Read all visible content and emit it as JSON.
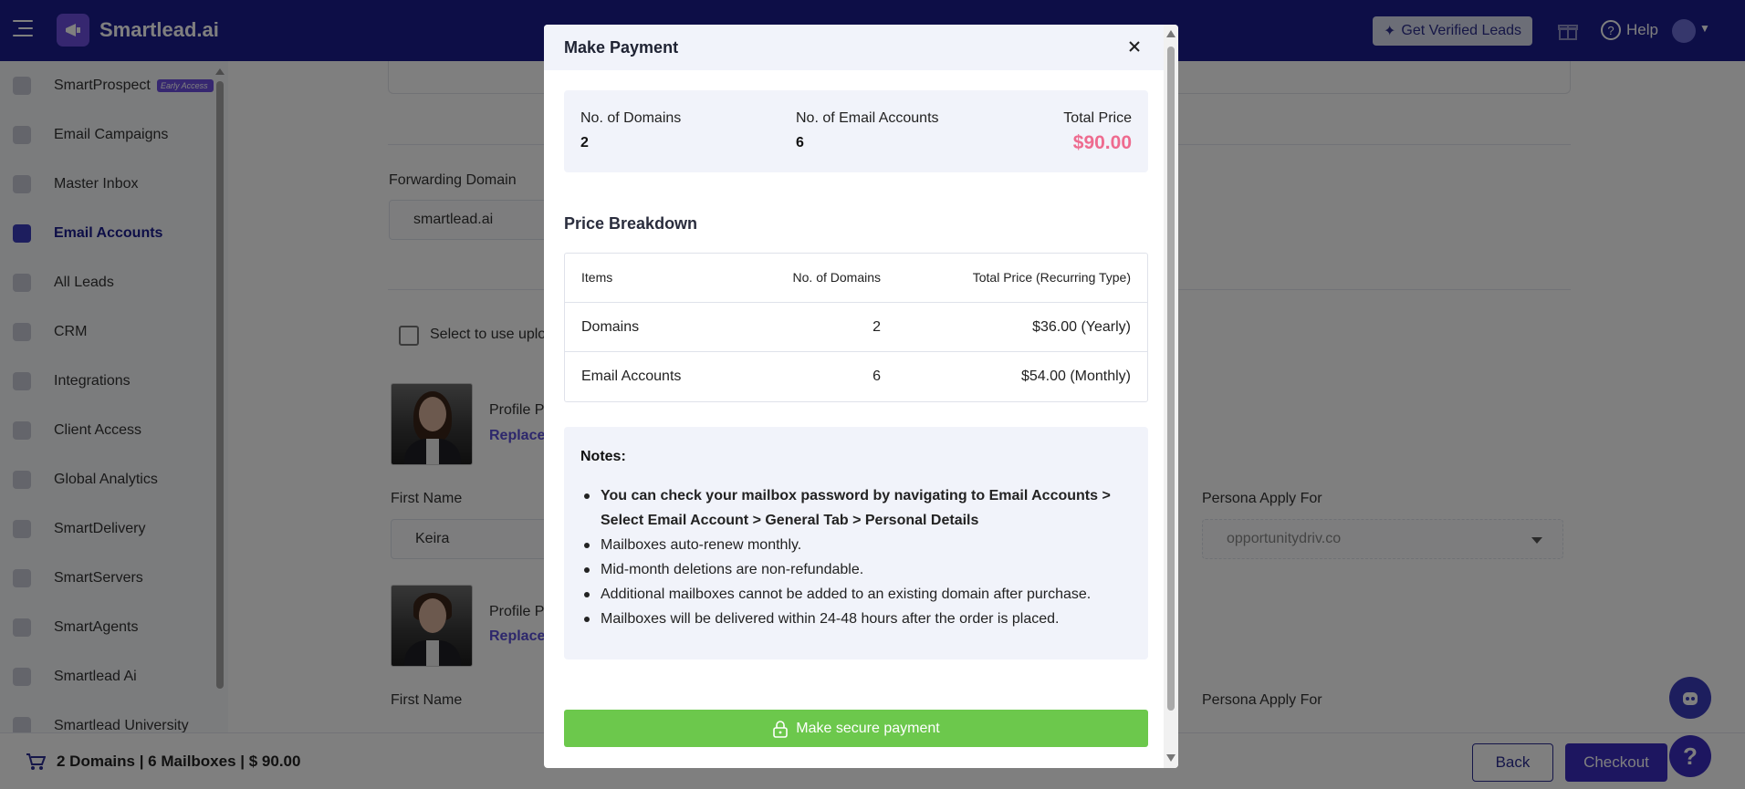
{
  "topbar": {
    "app_name": "Smartlead.ai",
    "verified_leads_label": "Get Verified Leads",
    "help_label": "Help"
  },
  "sidebar": {
    "items": [
      {
        "label": "SmartProspect",
        "icon": "users-icon",
        "badge": "Early Access"
      },
      {
        "label": "Email Campaigns",
        "icon": "megaphone-icon"
      },
      {
        "label": "Master Inbox",
        "icon": "inbox-icon"
      },
      {
        "label": "Email Accounts",
        "icon": "mail-icon",
        "active": true
      },
      {
        "label": "All Leads",
        "icon": "funnel-icon"
      },
      {
        "label": "CRM",
        "icon": "dollar-icon"
      },
      {
        "label": "Integrations",
        "icon": "puzzle-icon"
      },
      {
        "label": "Client Access",
        "icon": "bolt-icon"
      },
      {
        "label": "Global Analytics",
        "icon": "bar-chart-icon"
      },
      {
        "label": "SmartDelivery",
        "icon": "layers-icon"
      },
      {
        "label": "SmartServers",
        "icon": "server-icon"
      },
      {
        "label": "SmartAgents",
        "icon": "agent-icon"
      },
      {
        "label": "Smartlead Ai",
        "icon": "ai-icon"
      },
      {
        "label": "Smartlead University",
        "icon": "university-icon"
      }
    ]
  },
  "main": {
    "forwarding_domain_label": "Forwarding Domain",
    "forwarding_domain_value": "smartlead.ai",
    "checkbox_label": "Select to use uplo",
    "profile_label": "Profile P",
    "replace_label": "Replace",
    "first_name_label": "First Name",
    "first_name_value": "Keira",
    "persona_label": "Persona Apply For",
    "persona_value": "opportunitydriv.co"
  },
  "bottombar": {
    "summary": "2 Domains | 6 Mailboxes | $ 90.00",
    "back_label": "Back",
    "checkout_label": "Checkout"
  },
  "modal": {
    "title": "Make Payment",
    "summary": {
      "domains_label": "No. of Domains",
      "domains_value": "2",
      "accounts_label": "No. of Email Accounts",
      "accounts_value": "6",
      "total_label": "Total Price",
      "total_value": "$90.00"
    },
    "breakdown_title": "Price Breakdown",
    "table": {
      "headers": [
        "Items",
        "No. of Domains",
        "Total Price (Recurring Type)"
      ],
      "rows": [
        [
          "Domains",
          "2",
          "$36.00 (Yearly)"
        ],
        [
          "Email Accounts",
          "6",
          "$54.00 (Monthly)"
        ]
      ]
    },
    "notes_title": "Notes:",
    "notes": [
      "You can check your mailbox password by navigating to Email Accounts > Select Email Account > General Tab > Personal Details",
      "Mailboxes auto-renew monthly.",
      "Mid-month deletions are non-refundable.",
      "Additional mailboxes cannot be added to an existing domain after purchase.",
      "Mailboxes will be delivered within 24-48 hours after the order is placed."
    ],
    "pay_label": "Make secure payment"
  },
  "colors": {
    "nav_bg": "#1b1c8f",
    "accent": "#3b2dc0",
    "price": "#ee6b8f",
    "pay_button": "#6cc84c"
  }
}
